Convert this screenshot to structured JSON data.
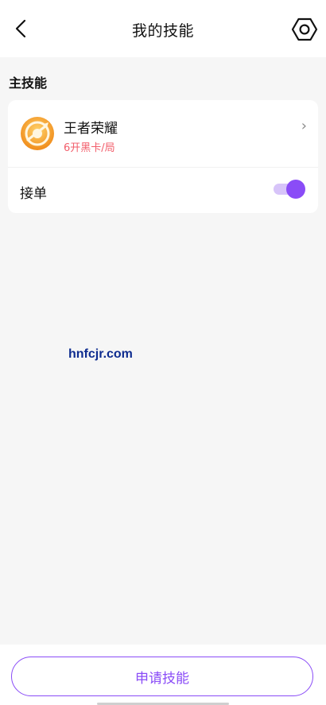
{
  "header": {
    "title": "我的技能",
    "back_icon": "back-arrow-icon",
    "settings_icon": "settings-hexagon-icon"
  },
  "section": {
    "title": "主技能"
  },
  "skill": {
    "name": "王者荣耀",
    "price": "6开黑卡/局",
    "icon": "game-logo-icon",
    "chevron_icon": "chevron-right-icon"
  },
  "order": {
    "label": "接单",
    "enabled": true
  },
  "watermark": "hnfcjr.com",
  "footer": {
    "apply_label": "申请技能"
  },
  "colors": {
    "accent": "#8a4cf7",
    "accent_light": "#d7c4f9",
    "price": "#f25d6a",
    "background": "#f6f6f6"
  }
}
